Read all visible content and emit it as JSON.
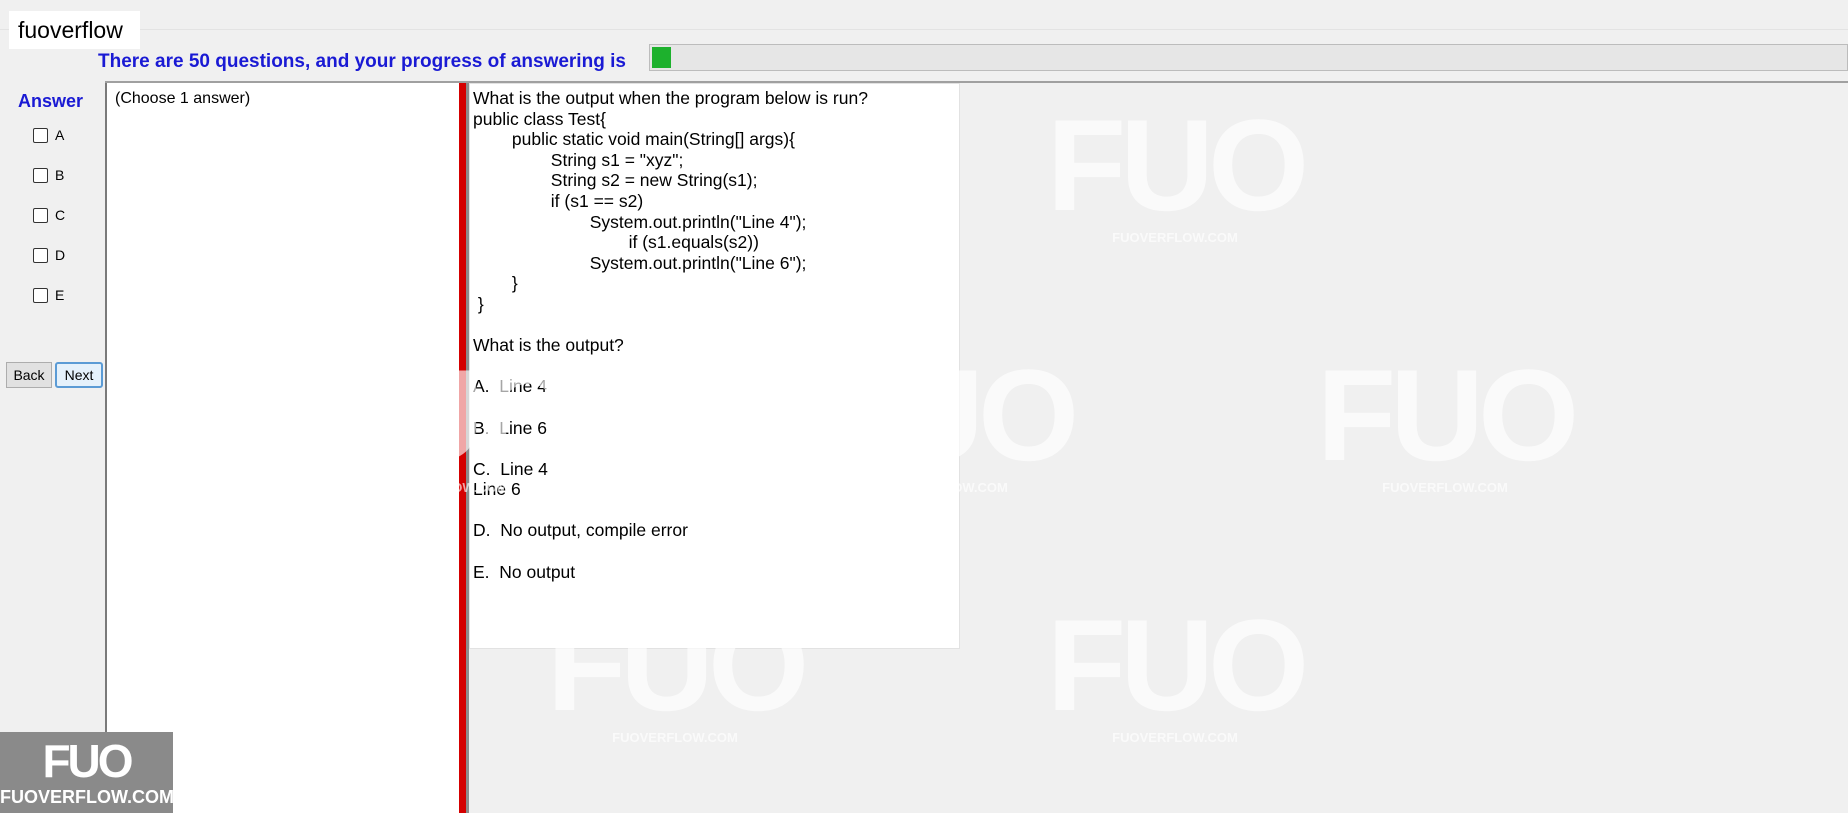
{
  "window": {
    "title": "fuoverflow"
  },
  "progress": {
    "text": "There are 50 questions, and your progress of answering is",
    "fraction": 0.016
  },
  "answer": {
    "label": "Answer",
    "options": [
      "A",
      "B",
      "C",
      "D",
      "E"
    ],
    "instruction": "(Choose 1 answer)"
  },
  "nav": {
    "back_label": "Back",
    "next_label": "Next"
  },
  "question": {
    "text": "What is the output when the program below is run?\npublic class Test{\n\tpublic static void main(String[] args){\n\t\tString s1 = \"xyz\";\n\t\tString s2 = new String(s1);\n\t\tif (s1 == s2)\n\t\t\tSystem.out.println(\"Line 4\");\n\t\t\t\tif (s1.equals(s2))\n\t\t\tSystem.out.println(\"Line 6\");\n\t}\n }\n\nWhat is the output?\n\nA.  Line 4\n\nB.  Line 6\n\nC.  Line 4\nLine 6\n\nD.  No output, compile error\n\nE.  No output"
  },
  "watermark": {
    "brand": "FUO",
    "site": "FUOVERFLOW.COM"
  },
  "logo": {
    "brand": "FUO",
    "site": "FUOVERFLOW.COM"
  },
  "colors": {
    "progress_text": "#1a1ad4",
    "progress_fill": "#1db12d",
    "divider": "#d40000"
  }
}
